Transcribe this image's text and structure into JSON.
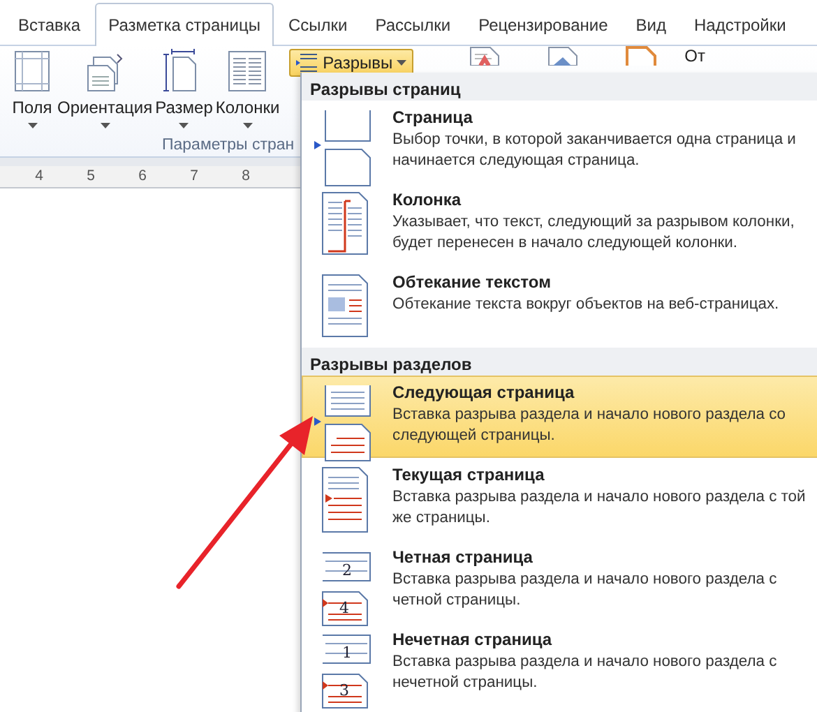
{
  "tabs": [
    {
      "label": "Вставка",
      "selected": false
    },
    {
      "label": "Разметка страницы",
      "selected": true
    },
    {
      "label": "Ссылки",
      "selected": false
    },
    {
      "label": "Рассылки",
      "selected": false
    },
    {
      "label": "Рецензирование",
      "selected": false
    },
    {
      "label": "Вид",
      "selected": false
    },
    {
      "label": "Надстройки",
      "selected": false
    }
  ],
  "ribbon": {
    "buttons": [
      {
        "label": "Поля",
        "kind": "margins"
      },
      {
        "label": "Ориентация",
        "kind": "orientation"
      },
      {
        "label": "Размер",
        "kind": "size"
      },
      {
        "label": "Колонки",
        "kind": "columns"
      }
    ],
    "group_label": "Параметры стран",
    "breaks_button": {
      "label": "Разрывы",
      "pressed": true
    },
    "right_text": "От"
  },
  "ruler": {
    "numbers": [
      "4",
      "5",
      "6",
      "7",
      "8"
    ]
  },
  "breaks_menu": {
    "sections": [
      {
        "title": "Разрывы страниц",
        "items": [
          {
            "title": "Страница",
            "description": "Выбор точки, в которой заканчивается одна страница и начинается следующая страница.",
            "kind": "page",
            "selected": false
          },
          {
            "title": "Колонка",
            "description": "Указывает, что текст, следующий за разрывом колонки, будет перенесен в начало следующей колонки.",
            "kind": "column",
            "selected": false
          },
          {
            "title": "Обтекание текстом",
            "description": "Обтекание текста вокруг объектов на веб-страницах.",
            "kind": "wrap",
            "selected": false
          }
        ]
      },
      {
        "title": "Разрывы разделов",
        "items": [
          {
            "title": "Следующая страница",
            "description": "Вставка разрыва раздела и начало нового раздела со следующей страницы.",
            "kind": "next",
            "selected": true
          },
          {
            "title": "Текущая страница",
            "description": "Вставка разрыва раздела и начало нового раздела с той же страницы.",
            "kind": "continuous",
            "selected": false
          },
          {
            "title": "Четная страница",
            "description": "Вставка разрыва раздела и начало нового раздела с четной страницы.",
            "kind": "even",
            "page_numbers": [
              "2",
              "4"
            ],
            "selected": false
          },
          {
            "title": "Нечетная страница",
            "description": "Вставка разрыва раздела и начало нового раздела с нечетной страницы.",
            "kind": "odd",
            "page_numbers": [
              "1",
              "3"
            ],
            "selected": false
          }
        ]
      }
    ]
  }
}
